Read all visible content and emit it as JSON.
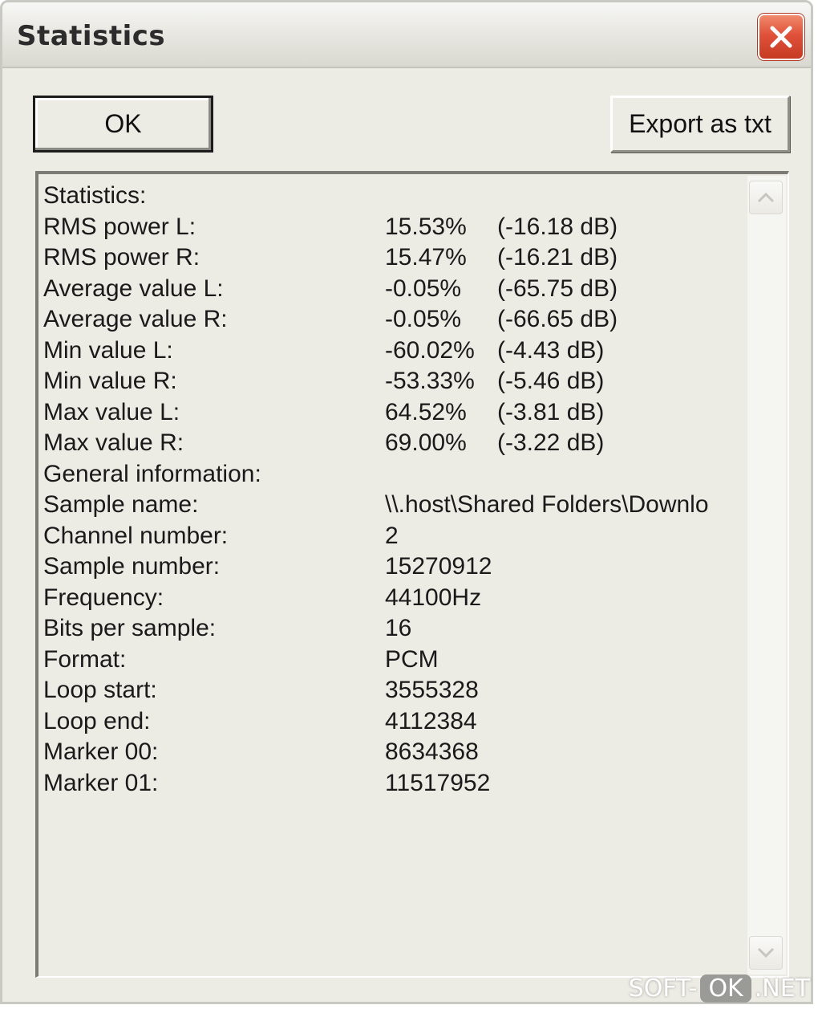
{
  "window": {
    "title": "Statistics",
    "close_icon": "close-x-icon"
  },
  "buttons": {
    "ok_label": "OK",
    "export_label": "Export as txt"
  },
  "stats": [
    {
      "label": "Statistics:",
      "value": "",
      "db": ""
    },
    {
      "label": "RMS power L:",
      "value": "15.53%",
      "db": "(-16.18 dB)"
    },
    {
      "label": "RMS power R:",
      "value": "15.47%",
      "db": "(-16.21 dB)"
    },
    {
      "label": "Average value L:",
      "value": "-0.05%",
      "db": "(-65.75 dB)"
    },
    {
      "label": "Average value R:",
      "value": "-0.05%",
      "db": "(-66.65 dB)"
    },
    {
      "label": "Min value L:",
      "value": "-60.02%",
      "db": "(-4.43 dB)"
    },
    {
      "label": "Min value R:",
      "value": "-53.33%",
      "db": "(-5.46 dB)"
    },
    {
      "label": "Max value L:",
      "value": "64.52%",
      "db": "(-3.81 dB)"
    },
    {
      "label": "Max value R:",
      "value": "69.00%",
      "db": "(-3.22 dB)"
    },
    {
      "label": "General information:",
      "value": "",
      "db": ""
    },
    {
      "label": "Sample name:",
      "value": "\\\\.host\\Shared Folders\\Downlo",
      "db": ""
    },
    {
      "label": "Channel number:",
      "value": "2",
      "db": ""
    },
    {
      "label": "Sample number:",
      "value": "15270912",
      "db": ""
    },
    {
      "label": "Frequency:",
      "value": "44100Hz",
      "db": ""
    },
    {
      "label": "Bits per sample:",
      "value": "16",
      "db": ""
    },
    {
      "label": "Format:",
      "value": "PCM",
      "db": ""
    },
    {
      "label": "Loop start:",
      "value": "3555328",
      "db": ""
    },
    {
      "label": "Loop end:",
      "value": "4112384",
      "db": ""
    },
    {
      "label": "Marker 00:",
      "value": "8634368",
      "db": ""
    },
    {
      "label": "Marker 01:",
      "value": "11517952",
      "db": ""
    }
  ],
  "scrollbar": {
    "up_icon": "chevron-up-icon",
    "down_icon": "chevron-down-icon"
  },
  "watermark": {
    "prefix": "SOFT-",
    "badge": "OK",
    "suffix": ".NET"
  }
}
